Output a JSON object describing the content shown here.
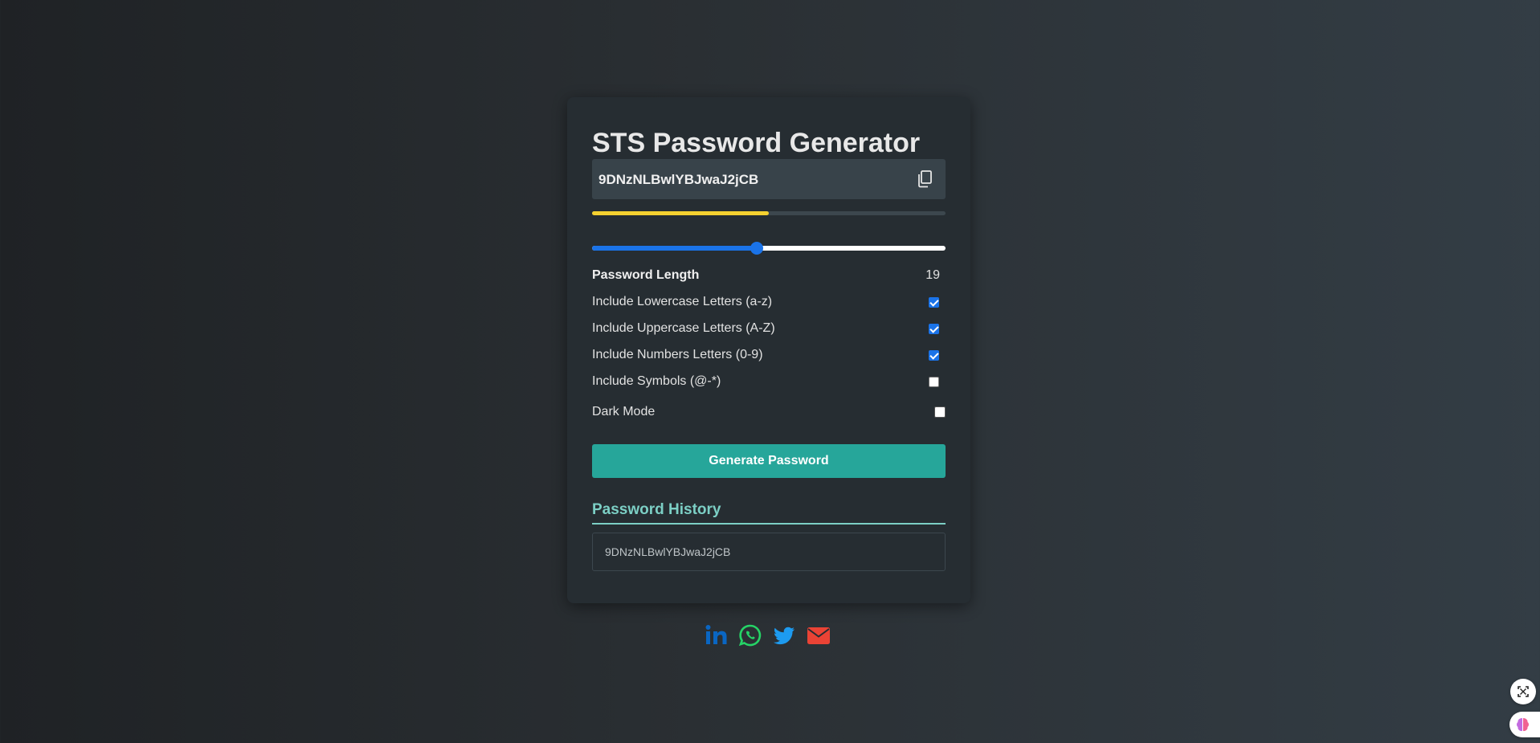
{
  "app": {
    "title": "STS Password Generator"
  },
  "password": {
    "value": "9DNzNLBwlYBJwaJ2jCB",
    "copy_icon": "copy-icon",
    "strength_fraction": 0.5,
    "strength_color": "#f5d130"
  },
  "length": {
    "label": "Password Length",
    "value": "19",
    "slider_fraction": 0.465
  },
  "options": [
    {
      "label": "Include Lowercase Letters (a-z)",
      "checked": true
    },
    {
      "label": "Include Uppercase Letters (A-Z)",
      "checked": true
    },
    {
      "label": "Include Numbers Letters (0-9)",
      "checked": true
    },
    {
      "label": "Include Symbols (@-*)",
      "checked": false
    }
  ],
  "dark_mode": {
    "label": "Dark Mode",
    "checked": false
  },
  "generate_button": {
    "label": "Generate Password"
  },
  "history": {
    "title": "Password History",
    "items": [
      "9DNzNLBwlYBJwaJ2jCB"
    ]
  },
  "social": {
    "icons": [
      "linkedin-icon",
      "whatsapp-icon",
      "twitter-icon",
      "email-icon"
    ],
    "colors": {
      "linkedin": "#0a66c2",
      "whatsapp": "#25d366",
      "twitter": "#1d9bf0",
      "email": "#ea4335"
    }
  },
  "colors": {
    "accent": "#26a69a",
    "history_accent": "#7ccfc5",
    "slider": "#1a73e8"
  }
}
